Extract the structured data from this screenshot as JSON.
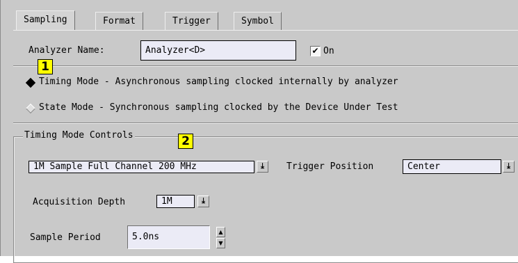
{
  "tabs": [
    {
      "label": "Sampling",
      "active": true
    },
    {
      "label": "Format",
      "active": false
    },
    {
      "label": "Trigger",
      "active": false
    },
    {
      "label": "Symbol",
      "active": false
    }
  ],
  "analyzer": {
    "name_label": "Analyzer Name:",
    "name_value": "Analyzer<D>",
    "on_label": "On",
    "on_checked": true,
    "check_glyph": "✔"
  },
  "callouts": {
    "one": "1",
    "two": "2"
  },
  "modes": {
    "timing": {
      "label": "Timing Mode - Asynchronous sampling clocked internally by analyzer",
      "selected": true
    },
    "state": {
      "label": "State Mode  - Synchronous sampling clocked by the Device Under Test",
      "selected": false
    }
  },
  "timing_controls": {
    "legend": "Timing Mode Controls",
    "sample_option": "1M Sample Full Channel 200 MHz",
    "trigger_position_label": "Trigger Position",
    "trigger_position_value": "Center",
    "acquisition_depth_label": "Acquisition Depth",
    "acquisition_depth_value": "1M",
    "sample_period_label": "Sample Period",
    "sample_period_value": "5.0ns"
  },
  "icons": {
    "dropdown": "⤓",
    "spin_up": "▲",
    "spin_down": "▼"
  }
}
